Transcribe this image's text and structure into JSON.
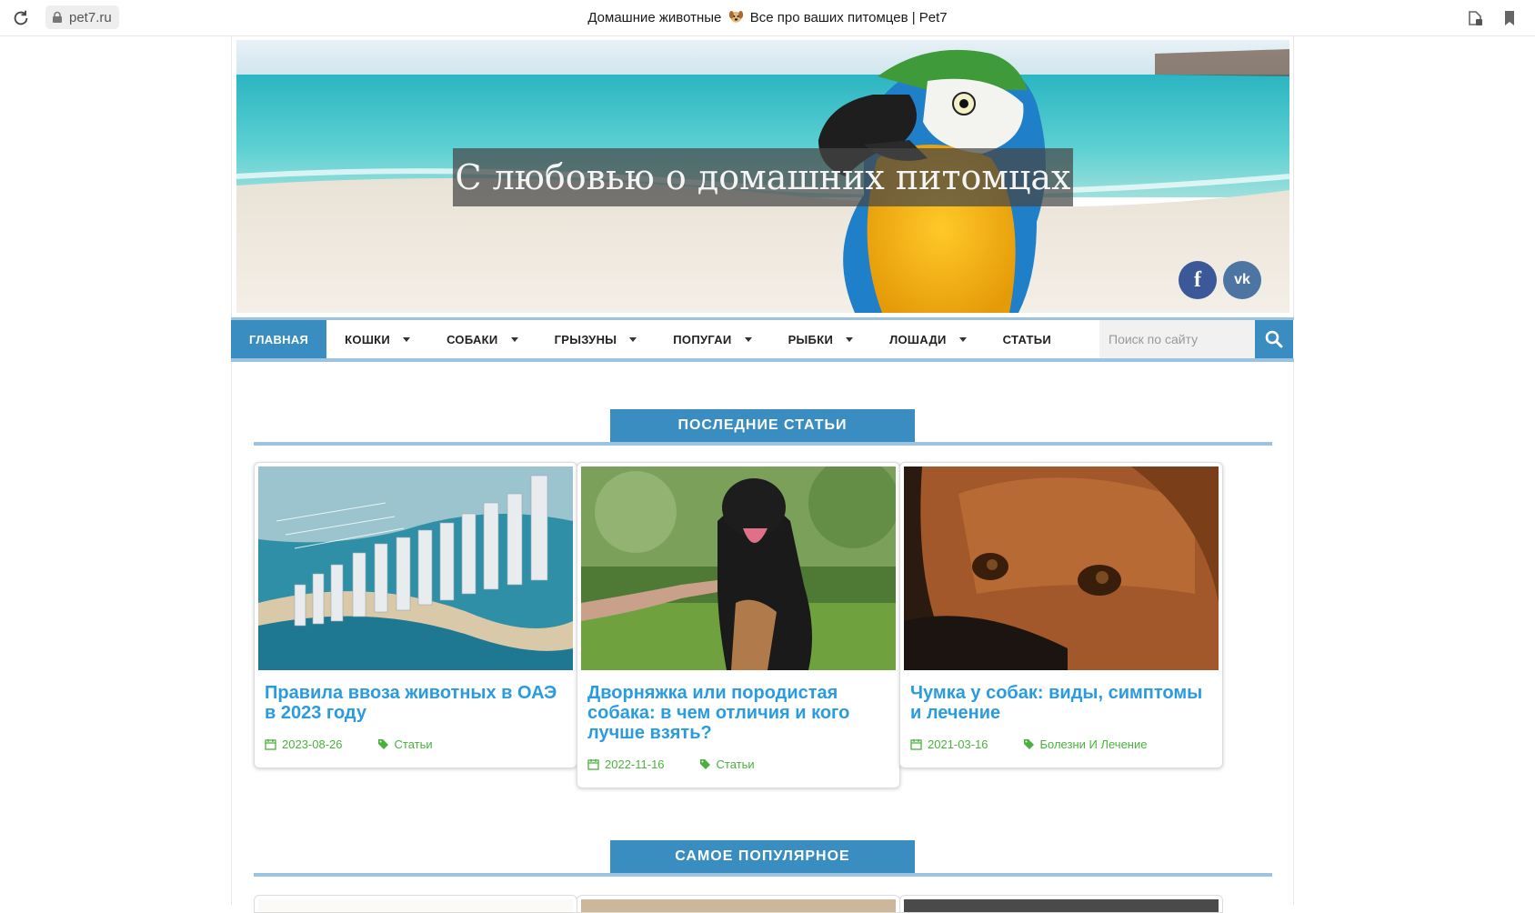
{
  "browser": {
    "url": "pet7.ru",
    "title_before": "Домашние животные",
    "title_after": "Все про ваших питомцев | Pet7",
    "title_emoji": "dog-face-icon"
  },
  "hero": {
    "caption": "С любовью о домашних питомцах",
    "social": [
      {
        "name": "facebook",
        "glyph": "f",
        "color": "#3b5998"
      },
      {
        "name": "vk",
        "glyph": "vk",
        "color": "#4c75a3"
      }
    ]
  },
  "nav": {
    "items": [
      {
        "label": "ГЛАВНАЯ",
        "active": true,
        "dropdown": false
      },
      {
        "label": "КОШКИ",
        "active": false,
        "dropdown": true
      },
      {
        "label": "СОБАКИ",
        "active": false,
        "dropdown": true
      },
      {
        "label": "ГРЫЗУНЫ",
        "active": false,
        "dropdown": true
      },
      {
        "label": "ПОПУГАИ",
        "active": false,
        "dropdown": true
      },
      {
        "label": "РЫБКИ",
        "active": false,
        "dropdown": true
      },
      {
        "label": "ЛОШАДИ",
        "active": false,
        "dropdown": true
      },
      {
        "label": "СТАТЬИ",
        "active": false,
        "dropdown": false
      }
    ],
    "search_placeholder": "Поиск по сайту"
  },
  "sections": {
    "latest": "ПОСЛЕДНИЕ СТАТЬИ",
    "popular": "САМОЕ ПОПУЛЯРНОЕ"
  },
  "articles": [
    {
      "title": "Правила ввоза животных в ОАЭ в 2023 году",
      "date": "2023-08-26",
      "category": "Статьи",
      "image": "dubai-aerial"
    },
    {
      "title": "Дворняжка или породистая собака: в чем отличия и кого лучше взять?",
      "date": "2022-11-16",
      "category": "Статьи",
      "image": "black-dog-paw"
    },
    {
      "title": "Чумка у собак: виды, симптомы и лечение",
      "date": "2021-03-16",
      "category": "Болезни И Лечение",
      "image": "beagle-face"
    }
  ],
  "colors": {
    "accent": "#3a8dc0",
    "accent_light": "#9cc3df",
    "link": "#2b9be0",
    "meta_green": "#48b23c"
  }
}
